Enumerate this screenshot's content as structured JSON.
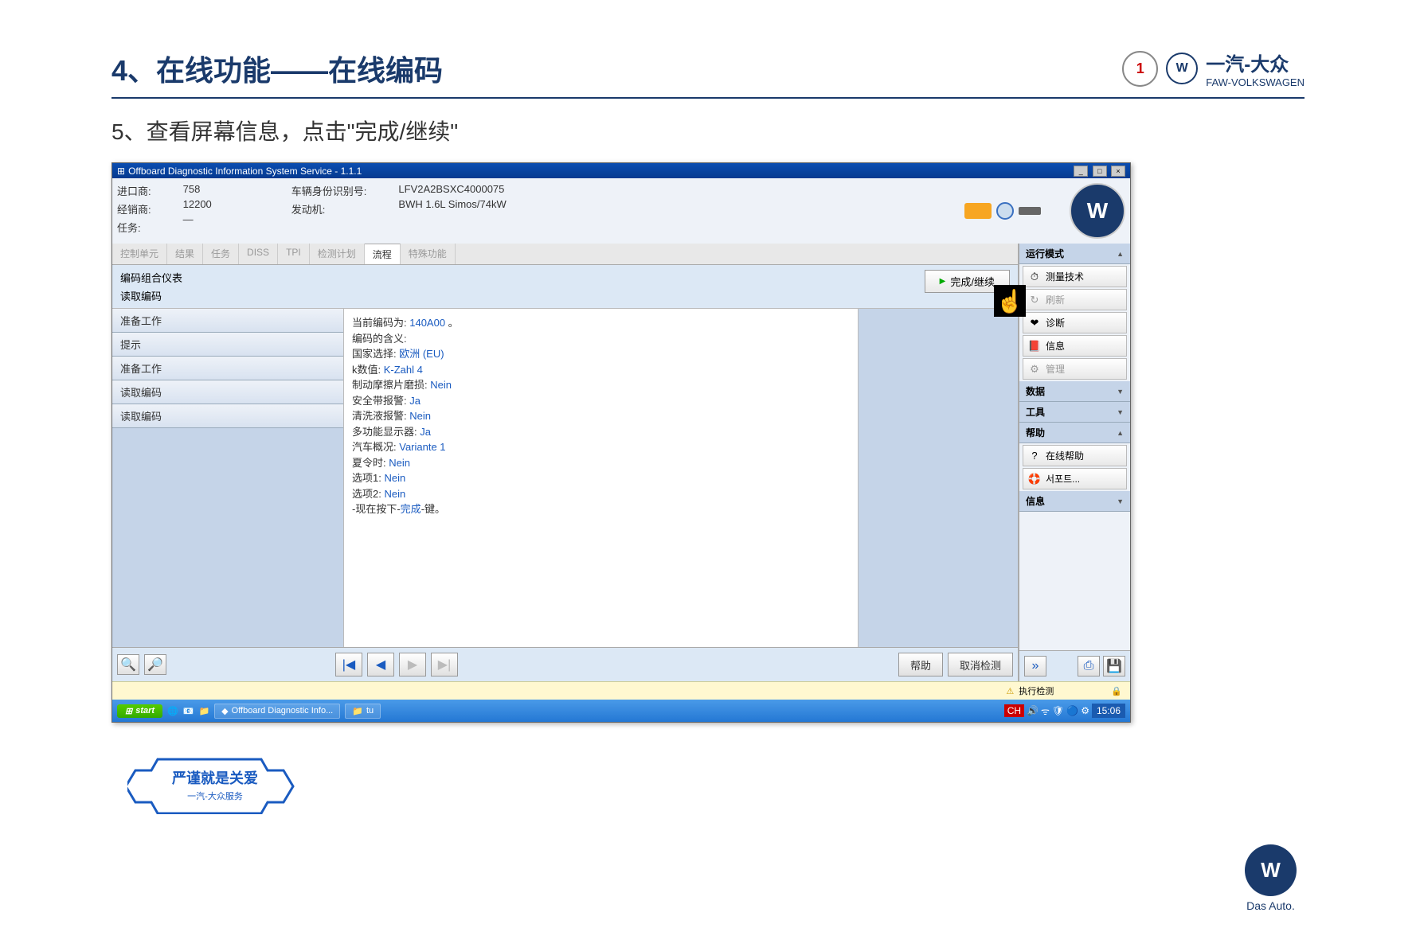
{
  "slide": {
    "title": "4、在线功能——在线编码",
    "step": "5、查看屏幕信息，点击\"完成/继续\"",
    "brand_text": "一汽-大众",
    "brand_sub": "FAW-VOLKSWAGEN"
  },
  "window": {
    "title": "Offboard Diagnostic Information System Service - 1.1.1",
    "info": {
      "importer_label": "进口商:",
      "importer_val": "758",
      "dealer_label": "经销商:",
      "dealer_val": "12200",
      "task_label": "任务:",
      "task_val": "—",
      "vin_label": "车辆身份识别号:",
      "vin_val": "LFV2A2BSXC4000075",
      "engine_label": "发动机:",
      "engine_val": "BWH 1.6L Simos/74kW"
    },
    "tabs": [
      "控制单元",
      "结果",
      "任务",
      "DISS",
      "TPI",
      "检测计划",
      "流程",
      "特殊功能"
    ],
    "active_tab": 6,
    "subheader": {
      "line1": "编码组合仪表",
      "line2": "读取编码",
      "complete": "完成/继续"
    },
    "steps": [
      "准备工作",
      "提示",
      "准备工作",
      "读取编码",
      "读取编码"
    ],
    "detail": [
      {
        "t": "当前编码为: ",
        "v": "140A00",
        "s": " 。"
      },
      {
        "t": "编码的含义:",
        "v": "",
        "s": ""
      },
      {
        "t": "国家选择: ",
        "v": "欧洲 (EU)",
        "s": ""
      },
      {
        "t": "k数值: ",
        "v": "K-Zahl 4",
        "s": ""
      },
      {
        "t": "制动摩擦片磨损: ",
        "v": "Nein",
        "s": ""
      },
      {
        "t": "安全带报警: ",
        "v": "Ja",
        "s": ""
      },
      {
        "t": "清洗液报警: ",
        "v": "Nein",
        "s": ""
      },
      {
        "t": "多功能显示器: ",
        "v": "Ja",
        "s": ""
      },
      {
        "t": "汽车概况: ",
        "v": "Variante 1",
        "s": ""
      },
      {
        "t": "夏令时: ",
        "v": "Nein",
        "s": ""
      },
      {
        "t": "选项1: ",
        "v": "Nein",
        "s": ""
      },
      {
        "t": "选项2: ",
        "v": "Nein",
        "s": ""
      },
      {
        "t": "",
        "v": "",
        "s": ""
      },
      {
        "t": "-现在按下-",
        "v": "完成",
        "s": "-键。"
      }
    ],
    "toolbar": {
      "help": "帮助",
      "cancel": "取消检测"
    },
    "side": {
      "mode_header": "运行模式",
      "mode_items": [
        {
          "icon": "⏱",
          "label": "测量技术",
          "disabled": false
        },
        {
          "icon": "↻",
          "label": "刷新",
          "disabled": true
        },
        {
          "icon": "❤",
          "label": "诊断",
          "disabled": false
        },
        {
          "icon": "📕",
          "label": "信息",
          "disabled": false
        },
        {
          "icon": "⚙",
          "label": "管理",
          "disabled": true
        }
      ],
      "data_header": "数据",
      "tool_header": "工具",
      "help_header": "帮助",
      "help_items": [
        {
          "icon": "?",
          "label": "在线帮助"
        },
        {
          "icon": "🛟",
          "label": "서포트..."
        }
      ],
      "info_header": "信息"
    },
    "warn": "执行检测"
  },
  "taskbar": {
    "start": "start",
    "app1": "Offboard Diagnostic Info...",
    "app2": "tu",
    "lang": "CH",
    "clock": "15:06"
  },
  "footer": {
    "badge_line1": "严谨就是关爱",
    "badge_line2": "一汽-大众服务",
    "das": "Das Auto."
  }
}
